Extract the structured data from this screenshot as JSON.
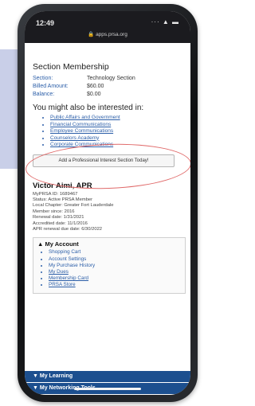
{
  "status_bar": {
    "time": "12:49",
    "icons": "··· ▲ ▬",
    "url": "🔒 apps.prsa.org"
  },
  "section_membership": {
    "title": "Section Membership",
    "rows": [
      {
        "label": "Section:",
        "value": "Technology Section"
      },
      {
        "label": "Billed Amount:",
        "value": "$60.00"
      },
      {
        "label": "Balance:",
        "value": "$0.00"
      }
    ]
  },
  "interests": {
    "heading": "You might also be interested in:",
    "items": [
      "Public Affairs and Government",
      "Financial Communications",
      "Employee Communications",
      "Counselors Academy",
      "Corporate Communications"
    ],
    "add_button": "Add a Professional Interest Section Today!"
  },
  "profile": {
    "name": "Victor Aimi, APR",
    "lines": [
      "MyPRSA ID: 1689467",
      "Status: Active PRSA Member",
      "Local Chapter: Greater Fort Lauderdale",
      "Member since: 2016",
      "Renewal date: 1/31/2021",
      "Accredited date: 11/1/2016",
      "APR renewal due date: 6/30/2022"
    ]
  },
  "my_account": {
    "heading": "▲ My Account",
    "items": [
      "Shopping Cart",
      "Account Settings",
      "My Purchase History",
      "My Dues",
      "Membership Card",
      "PRSA Store"
    ]
  },
  "bottom_bars": [
    "▼ My Learning",
    "▼ My Networking Tools"
  ]
}
